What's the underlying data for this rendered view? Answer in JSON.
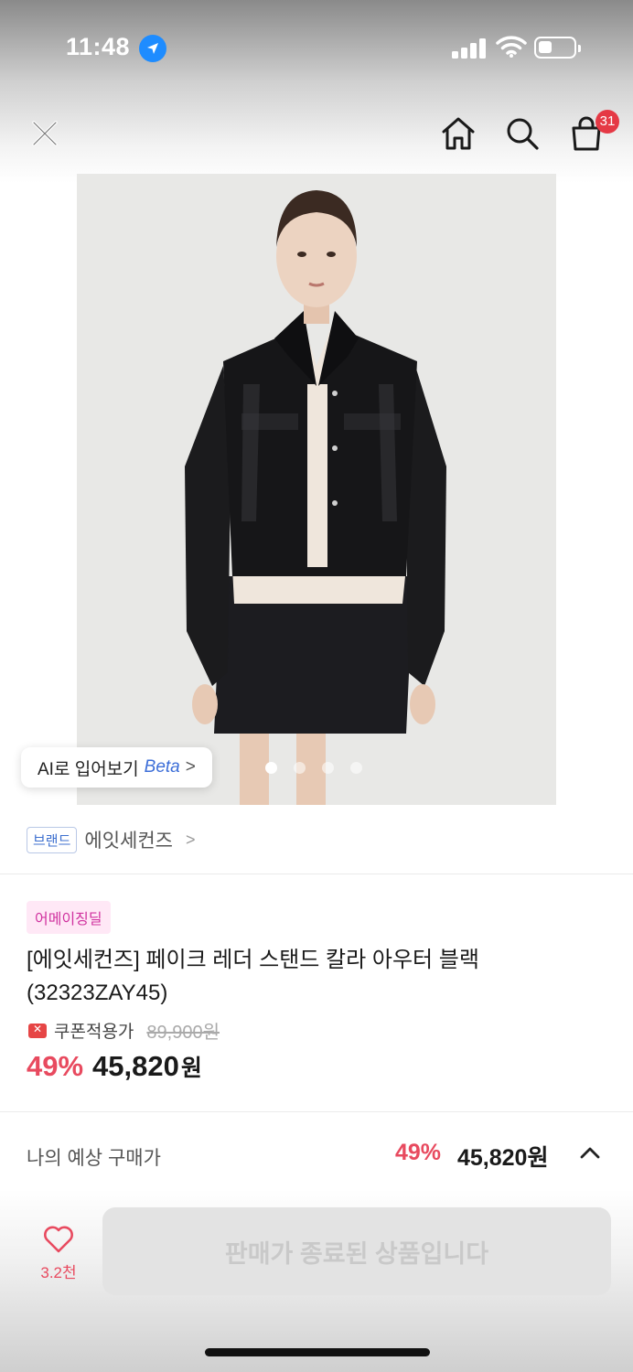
{
  "status_bar": {
    "time": "11:48"
  },
  "nav": {
    "cart_count": "31"
  },
  "hero": {
    "tryon_label": "AI로 입어보기",
    "tryon_beta": "Beta",
    "tryon_chevron": ">",
    "image_count": 4,
    "active_index": 0
  },
  "brand": {
    "tag": "브랜드",
    "name": "에잇세컨즈",
    "chevron": ">"
  },
  "product": {
    "deal_tag": "어메이징딜",
    "title": "[에잇세컨즈] 페이크 레더 스탠드 칼라 아우터  블랙 (32323ZAY45)",
    "coupon_label": "쿠폰적용가",
    "original_price": "89,900원",
    "discount": "49%",
    "price": "45,820",
    "currency": "원"
  },
  "expected": {
    "label": "나의 예상 구매가",
    "discount": "49%",
    "price": "45,820원"
  },
  "bottom": {
    "like_count": "3.2천",
    "buy_label": "판매가 종료된 상품입니다"
  },
  "colors": {
    "accent_red": "#e84a5f",
    "brand_blue": "#3d6fcf",
    "deal_pink": "#d0329f",
    "badge_red": "#e53945"
  },
  "icons": [
    "location-arrow-icon",
    "signal-icon",
    "wifi-icon",
    "battery-icon",
    "close-icon",
    "home-icon",
    "search-icon",
    "cart-icon",
    "heart-icon",
    "chevron-up-icon",
    "coupon-icon"
  ]
}
